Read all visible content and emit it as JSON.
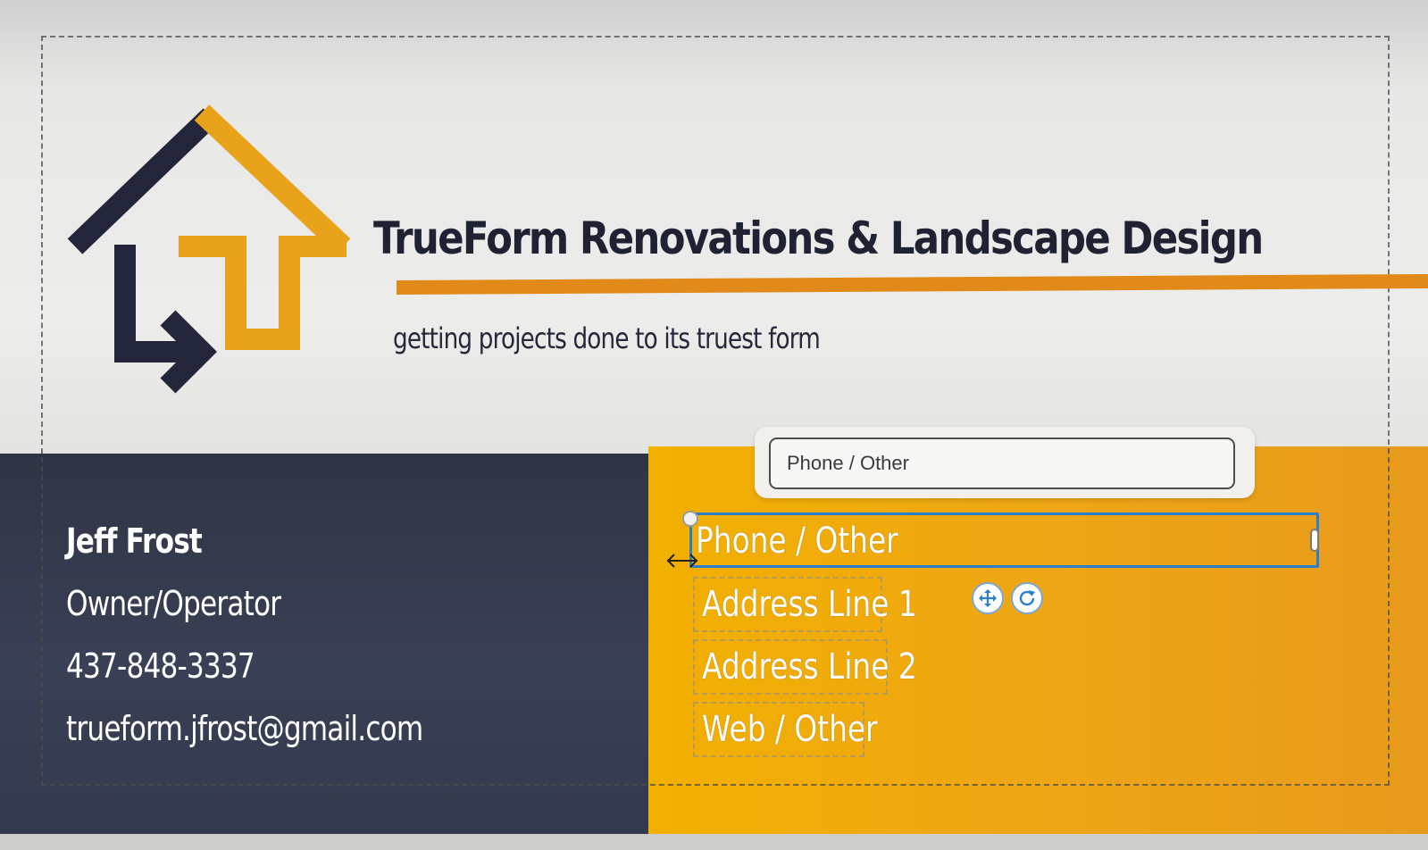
{
  "brand": {
    "title": "TrueForm Renovations & Landscape Design",
    "tagline": "getting projects done to its truest form"
  },
  "contact": {
    "name": "Jeff Frost",
    "role": "Owner/Operator",
    "phone": "437-848-3337",
    "email": "trueform.jfrost@gmail.com"
  },
  "editor": {
    "text_input_value": "Phone / Other",
    "fields": [
      {
        "id": "phone",
        "label": "Phone / Other",
        "selected": true
      },
      {
        "id": "address1",
        "label": "Address Line 1",
        "selected": false
      },
      {
        "id": "address2",
        "label": "Address Line 2",
        "selected": false
      },
      {
        "id": "web",
        "label": "Web / Other",
        "selected": false
      }
    ],
    "tools": [
      "move-icon",
      "rotate-icon"
    ]
  },
  "colors": {
    "navy": "#2f3445",
    "orange": "#f2b000",
    "accent_rule": "#e18a19",
    "selection": "#2b7fc8"
  }
}
